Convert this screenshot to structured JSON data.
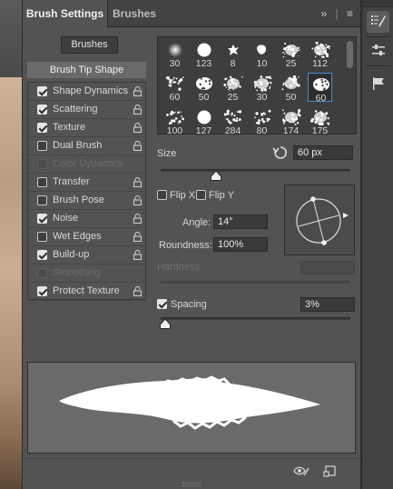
{
  "tabs": {
    "active": "Brush Settings",
    "inactive": "Brushes"
  },
  "tab_icons": {
    "expand": "»",
    "menu": "≡"
  },
  "left": {
    "brushes_button": "Brushes",
    "tip_shape": "Brush Tip Shape",
    "options": [
      {
        "label": "Shape Dynamics",
        "checked": true,
        "enabled": true
      },
      {
        "label": "Scattering",
        "checked": true,
        "enabled": true
      },
      {
        "label": "Texture",
        "checked": true,
        "enabled": true
      },
      {
        "label": "Dual Brush",
        "checked": false,
        "enabled": true
      },
      {
        "label": "Color Dynamics",
        "checked": false,
        "enabled": false
      },
      {
        "label": "Transfer",
        "checked": false,
        "enabled": true
      },
      {
        "label": "Brush Pose",
        "checked": false,
        "enabled": true
      },
      {
        "label": "Noise",
        "checked": true,
        "enabled": true
      },
      {
        "label": "Wet Edges",
        "checked": false,
        "enabled": true
      },
      {
        "label": "Build-up",
        "checked": true,
        "enabled": true
      },
      {
        "label": "Smoothing",
        "checked": false,
        "enabled": false
      },
      {
        "label": "Protect Texture",
        "checked": true,
        "enabled": true
      }
    ]
  },
  "brush_grid": [
    {
      "size": "30",
      "kind": "soft"
    },
    {
      "size": "123",
      "kind": "hard"
    },
    {
      "size": "8",
      "kind": "splat"
    },
    {
      "size": "10",
      "kind": "blob"
    },
    {
      "size": "25",
      "kind": "spray"
    },
    {
      "size": "112",
      "kind": "spray"
    },
    {
      "size": "60",
      "kind": "dots"
    },
    {
      "size": "50",
      "kind": "chalk"
    },
    {
      "size": "25",
      "kind": "spray"
    },
    {
      "size": "30",
      "kind": "spray"
    },
    {
      "size": "50",
      "kind": "spray"
    },
    {
      "size": "60",
      "kind": "chalk"
    },
    {
      "size": "100",
      "kind": "dots"
    },
    {
      "size": "127",
      "kind": "hard"
    },
    {
      "size": "284",
      "kind": "dots"
    },
    {
      "size": "80",
      "kind": "dots"
    },
    {
      "size": "174",
      "kind": "spray"
    },
    {
      "size": "175",
      "kind": "spray"
    }
  ],
  "selected_brush_index": 11,
  "size": {
    "label": "Size",
    "value": "60 px",
    "slider": 0.29
  },
  "flip": {
    "x_label": "Flip X",
    "y_label": "Flip Y",
    "x_checked": false,
    "y_checked": false
  },
  "angle": {
    "label": "Angle:",
    "value": "14°"
  },
  "roundness": {
    "label": "Roundness:",
    "value": "100%"
  },
  "hardness": {
    "label": "Hardness",
    "enabled": false
  },
  "spacing": {
    "label": "Spacing",
    "value": "3%",
    "checked": true,
    "slider": 0.0
  },
  "icons": {
    "preview_toggle": "eye-pencil-icon",
    "new_preset": "new-brush-preset-icon",
    "reset_size": "reset-arrow-icon"
  },
  "rightbar": [
    "brush-settings-icon",
    "adjustments-icon",
    "flag-icon"
  ]
}
